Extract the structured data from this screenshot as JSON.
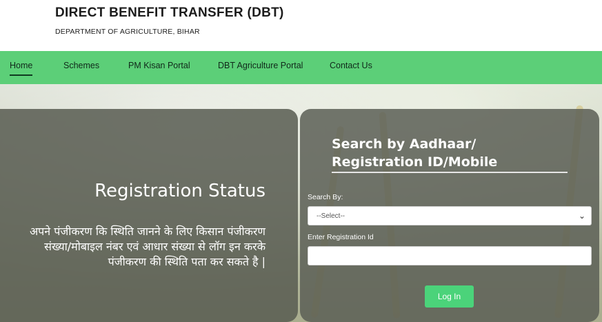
{
  "header": {
    "title": "DIRECT BENEFIT TRANSFER (DBT)",
    "subtitle": "DEPARTMENT OF AGRICULTURE, BIHAR"
  },
  "nav": {
    "items": [
      {
        "label": "Home",
        "active": true
      },
      {
        "label": "Schemes"
      },
      {
        "label": "PM Kisan Portal"
      },
      {
        "label": "DBT Agriculture Portal"
      },
      {
        "label": "Contact Us"
      }
    ]
  },
  "left_panel": {
    "title": "Registration Status",
    "description": "अपने पंजीकरण कि स्थिति जानने के लिए किसान पंजीकरण संख्या/मोबाइल नंबर एवं आधार संख्या से लॉग इन करके पंजीकरण की स्थिति पता कर सकते है |"
  },
  "search_form": {
    "heading": "Search by Aadhaar/ Registration ID/Mobile",
    "search_by_label": "Search By:",
    "search_by_selected": "--Select--",
    "registration_label": "Enter Registration Id",
    "registration_value": "",
    "login_button": "Log In"
  },
  "colors": {
    "nav_background": "#5ccf78",
    "login_button": "#4bd37a",
    "panel_background": "#5c6056"
  }
}
